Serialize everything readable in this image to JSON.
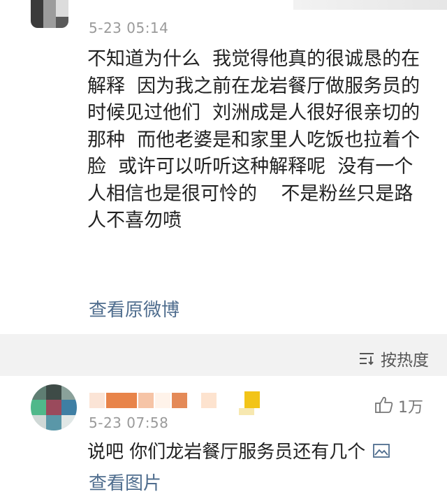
{
  "comment_1": {
    "time": "5-23 05:14",
    "text": "不知道为什么  我觉得他真的很诚恳的在解释  因为我之前在龙岩餐厅做服务员的时候见过他们  刘洲成是人很好很亲切的那种  而他老婆是和家里人吃饭也拉着个脸  或许可以听听这种解释呢  没有一个人相信也是很可怜的    不是粉丝只是路人不喜勿喷",
    "view_original_label": "查看原微博",
    "avatar_icon": "avatar-icon"
  },
  "sort": {
    "label": "按热度",
    "icon": "sort-icon"
  },
  "comment_2": {
    "time": "5-23 07:58",
    "like_count": "1万",
    "like_icon": "thumbs-up-icon",
    "text": "说吧  你们龙岩餐厅服务员还有几个",
    "image_icon": "image-icon",
    "view_image_label": "查看图片",
    "avatar_icon": "avatar-icon"
  },
  "colors": {
    "link": "#4f6d8e",
    "text": "#222222",
    "meta": "#9a9a9a",
    "band": "#f2f2f2"
  }
}
